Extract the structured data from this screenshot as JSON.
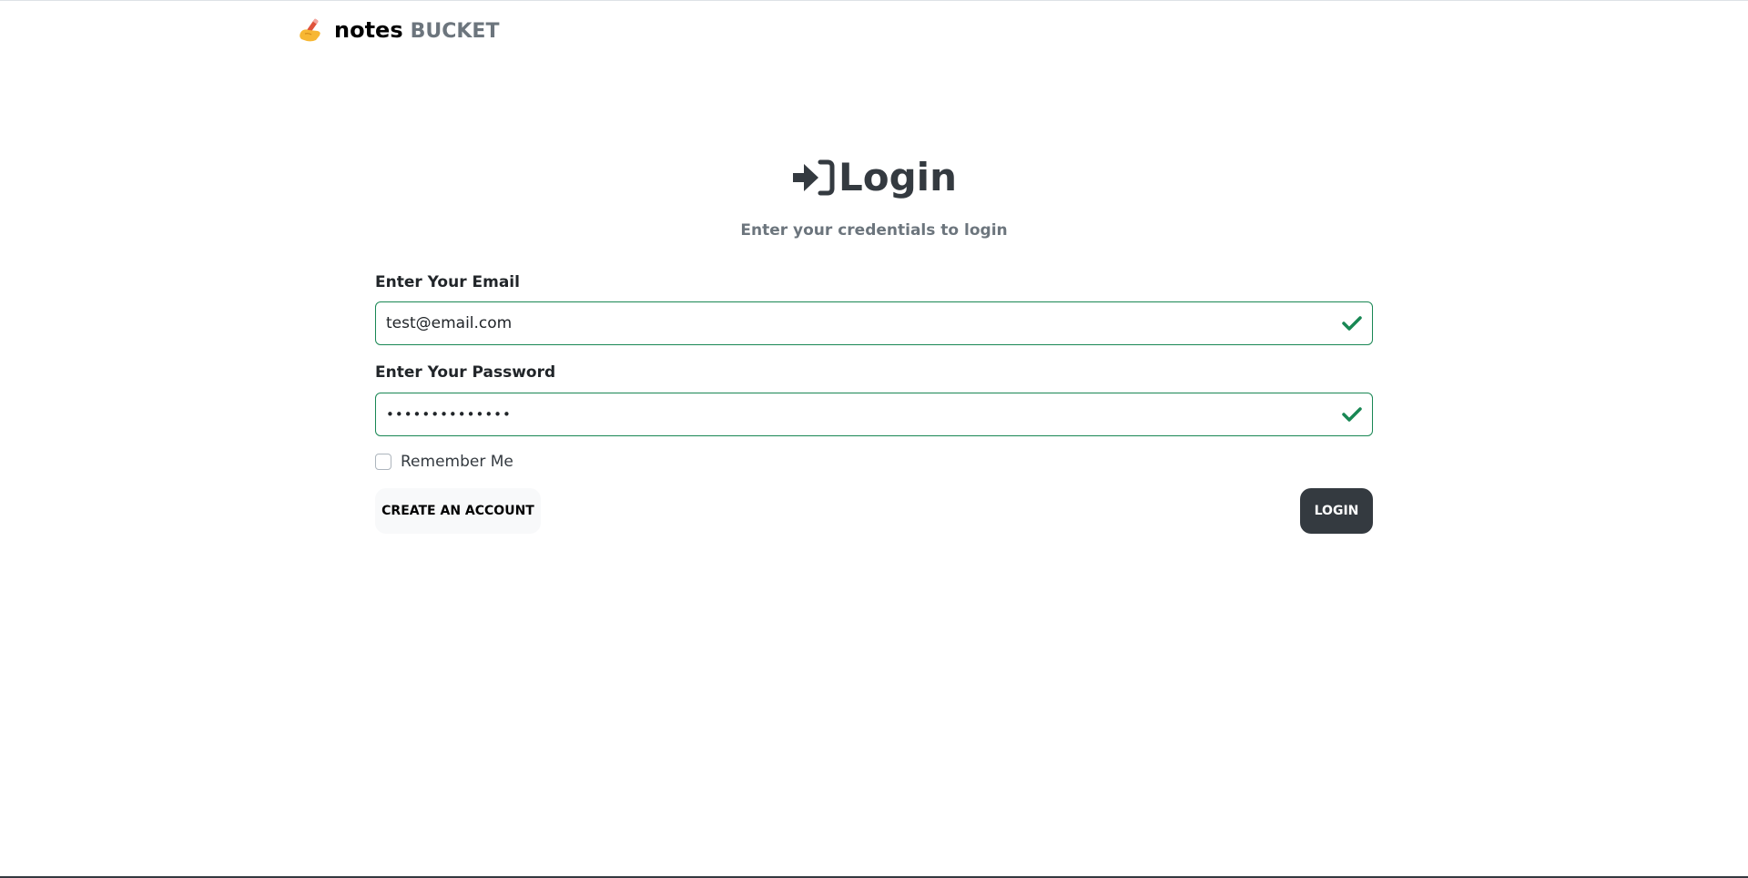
{
  "navbar": {
    "brand_icon": "writing-hand-icon",
    "brand_notes": "notes",
    "brand_bucket": "BUCKET"
  },
  "login": {
    "title_icon": "sign-in-icon",
    "title": "Login",
    "subtitle": "Enter your credentials to login",
    "email": {
      "label": "Enter Your Email",
      "value": "test@email.com",
      "status_icon": "check-icon"
    },
    "password": {
      "label": "Enter Your Password",
      "value": "••••••••••••••",
      "status_icon": "check-icon"
    },
    "remember_label": "Remember Me",
    "remember_checked": false,
    "create_account_label": "CREATE AN ACCOUNT",
    "login_button_label": "LOGIN"
  },
  "colors": {
    "valid_green": "#198754",
    "dark": "#343a40",
    "muted": "#6c757d"
  }
}
